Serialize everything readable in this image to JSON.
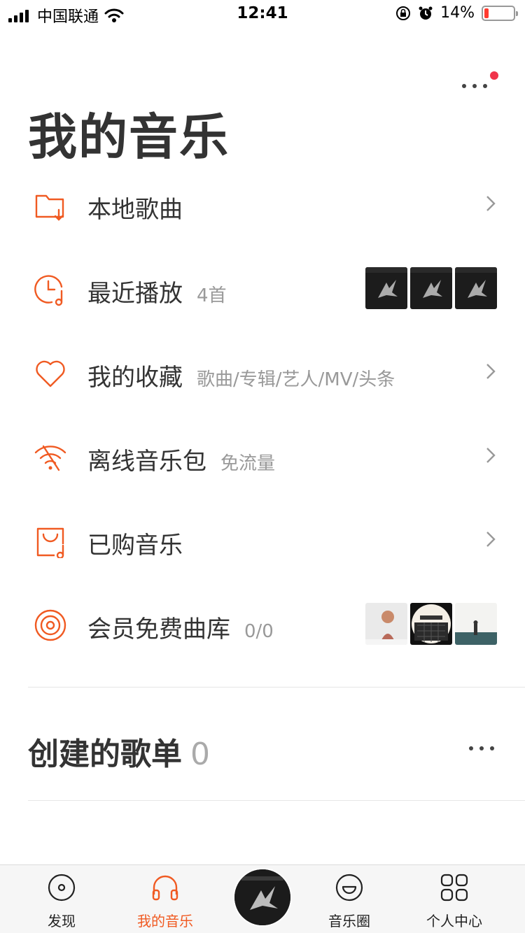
{
  "status_bar": {
    "carrier": "中国联通",
    "time": "12:41",
    "battery": "14%",
    "battery_level": 0.14
  },
  "header": {
    "title": "我的音乐",
    "more_icon": "more-dots-icon",
    "has_notification": true
  },
  "menu": [
    {
      "label": "本地歌曲",
      "sub": "",
      "icon": "folder-download-icon",
      "trailing": "chevron"
    },
    {
      "label": "最近播放",
      "sub": "4首",
      "icon": "clock-music-icon",
      "trailing": "thumbs"
    },
    {
      "label": "我的收藏",
      "sub": "歌曲/专辑/艺人/MV/头条",
      "icon": "heart-icon",
      "trailing": "chevron"
    },
    {
      "label": "离线音乐包",
      "sub": "免流量",
      "icon": "wifi-offline-icon",
      "trailing": "chevron"
    },
    {
      "label": "已购音乐",
      "sub": "",
      "icon": "bag-music-icon",
      "trailing": "chevron"
    },
    {
      "label": "会员免费曲库",
      "sub": "0/0",
      "icon": "vinyl-icon",
      "trailing": "thumbs"
    }
  ],
  "playlists": {
    "title": "创建的歌单",
    "count": "0"
  },
  "tabs": [
    {
      "label": "发现",
      "icon": "disc-icon"
    },
    {
      "label": "我的音乐",
      "icon": "headphones-icon",
      "active": true
    },
    {
      "label": "",
      "icon": "now-playing-disc"
    },
    {
      "label": "音乐圈",
      "icon": "smile-circle-icon"
    },
    {
      "label": "个人中心",
      "icon": "grid-icon"
    }
  ],
  "colors": {
    "accent": "#f05a22",
    "text": "#333333",
    "muted": "#999999",
    "badge": "#f0344b"
  }
}
